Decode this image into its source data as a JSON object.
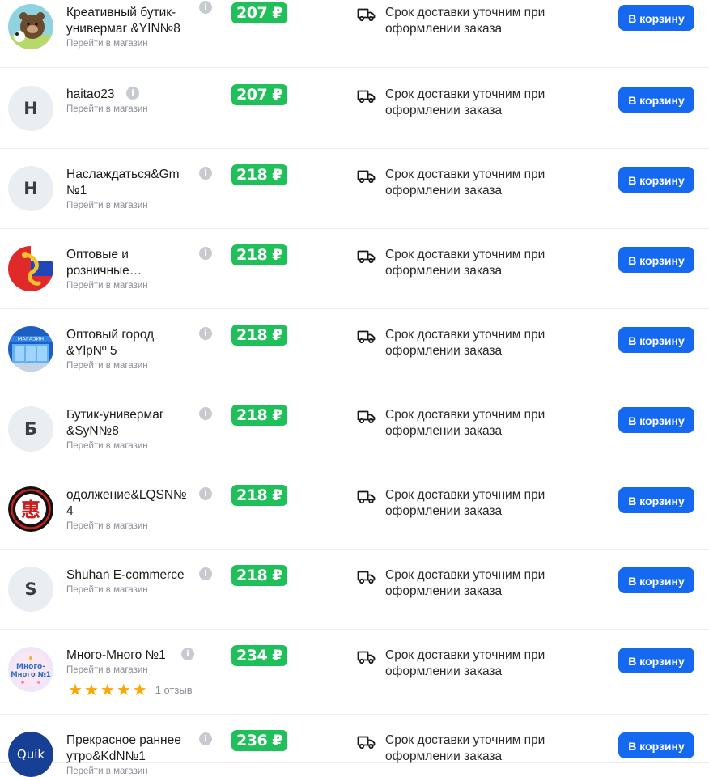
{
  "shop_link_label": "Перейти в магазин",
  "delivery_text": "Срок доставки уточним при оформлении заказа",
  "cart_label": "В корзину",
  "offers": [
    {
      "name": "Креативный бутик-универмаг &YIN№8",
      "price": "207 ₽",
      "avatar": {
        "kind": "image",
        "icon": "bear-avatar"
      }
    },
    {
      "name": "haitao23",
      "price": "207 ₽",
      "avatar": {
        "kind": "letter",
        "letter": "H"
      }
    },
    {
      "name": "Наслаждаться&Gm №1",
      "price": "218 ₽",
      "avatar": {
        "kind": "letter",
        "letter": "H"
      }
    },
    {
      "name": "Оптовые и розничные…",
      "price": "218 ₽",
      "avatar": {
        "kind": "image",
        "icon": "dragon-flag-avatar"
      }
    },
    {
      "name": "Оптовый город &YlpNº 5",
      "price": "218 ₽",
      "avatar": {
        "kind": "image",
        "icon": "store-avatar",
        "text": "МАГАЗИН"
      }
    },
    {
      "name": "Бутик-универмаг &SyN№8",
      "price": "218 ₽",
      "avatar": {
        "kind": "letter",
        "letter": "Б"
      }
    },
    {
      "name": "одолжение&LQSN№ 4",
      "price": "218 ₽",
      "avatar": {
        "kind": "image",
        "icon": "hui-seal-avatar",
        "text": "惠"
      }
    },
    {
      "name": "Shuhan E-commerce",
      "price": "218 ₽",
      "avatar": {
        "kind": "letter",
        "letter": "S"
      }
    },
    {
      "name": "Много-Много №1",
      "price": "234 ₽",
      "avatar": {
        "kind": "image",
        "icon": "mnogo-avatar",
        "text": "Много-Много №1"
      },
      "rating": 5,
      "reviews": "1 отзыв"
    },
    {
      "name": "Прекрасное раннее утро&KdN№1",
      "price": "236 ₽",
      "avatar": {
        "kind": "image",
        "icon": "quik-avatar",
        "text": "Quik"
      }
    }
  ]
}
